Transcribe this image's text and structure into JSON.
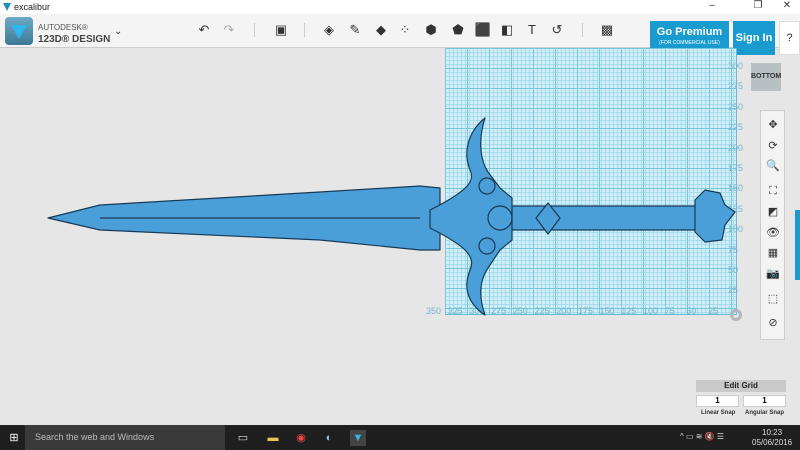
{
  "window": {
    "title": "excalibur",
    "minimize": "–",
    "restore": "❐",
    "close": "✕"
  },
  "app": {
    "brand_top": "AUTODESK®",
    "brand_bottom": "123D® DESIGN",
    "menu": "⌄"
  },
  "toolbar": {
    "icons": [
      {
        "name": "undo-icon",
        "glyph": "↶"
      },
      {
        "name": "redo-icon",
        "glyph": "↷"
      },
      {
        "name": "primitives-icon",
        "glyph": "▣"
      },
      {
        "name": "sketch-icon",
        "glyph": "◈"
      },
      {
        "name": "construct-icon",
        "glyph": "✎"
      },
      {
        "name": "modify-icon",
        "glyph": "◆"
      },
      {
        "name": "pattern-icon",
        "glyph": "⁘"
      },
      {
        "name": "grouping-icon",
        "glyph": "⬢"
      },
      {
        "name": "combine-icon",
        "glyph": "⬟"
      },
      {
        "name": "measure-icon",
        "glyph": "⬛"
      },
      {
        "name": "solid-icon",
        "glyph": "◧"
      },
      {
        "name": "text-icon",
        "glyph": "T"
      },
      {
        "name": "snap-icon",
        "glyph": "↺"
      },
      {
        "name": "material-icon",
        "glyph": "▩"
      }
    ],
    "premium": "Go Premium",
    "premium_sub": "(FOR COMMERCIAL USE)",
    "signin": "Sign In",
    "help": "?"
  },
  "viewport": {
    "view_cube": "BOTTOM",
    "grid_color": "#cfeef8",
    "model_color": "#4a9fd8",
    "y_labels": [
      "300",
      "275",
      "250",
      "225",
      "200",
      "175",
      "150",
      "125",
      "100",
      "75",
      "50",
      "25"
    ],
    "x_labels": [
      "350",
      "325",
      "300",
      "275",
      "250",
      "225",
      "200",
      "175",
      "150",
      "125",
      "100",
      "75",
      "50",
      "25"
    ]
  },
  "nav_tools": [
    {
      "name": "pan-icon",
      "glyph": "✥"
    },
    {
      "name": "orbit-icon",
      "glyph": "⟳"
    },
    {
      "name": "zoom-icon",
      "glyph": "🔍"
    },
    {
      "name": "fit-icon",
      "glyph": "⛶"
    },
    {
      "name": "views-icon",
      "glyph": "◩"
    },
    {
      "name": "visibility-icon",
      "glyph": "👁"
    },
    {
      "name": "materials-icon",
      "glyph": "▦"
    },
    {
      "name": "camera-icon",
      "glyph": "📷"
    },
    {
      "name": "select-icon",
      "glyph": "⬚"
    },
    {
      "name": "hide-icon",
      "glyph": "⊘"
    }
  ],
  "grid_panel": {
    "title": "Edit Grid",
    "linear": "1",
    "angular": "1",
    "linear_label": "Linear Snap",
    "angular_label": "Angular Snap"
  },
  "taskbar": {
    "search": "Search the web and Windows",
    "time": "10:23",
    "date": "05/06/2016",
    "tray": "^  ▭  ≋  🔇  ☰"
  }
}
